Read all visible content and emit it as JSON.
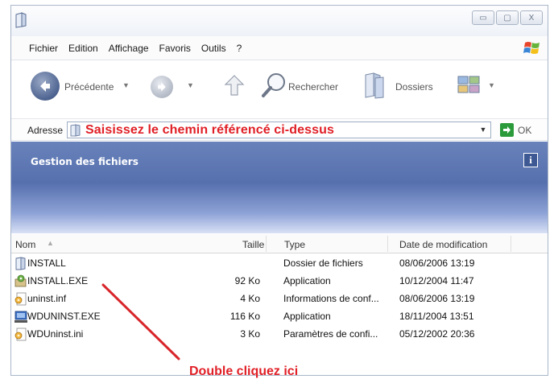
{
  "window": {
    "title_icon": "folder-icon",
    "buttons": [
      "minimize",
      "maximize",
      "close"
    ],
    "minimize_glyph": "▭",
    "maximize_glyph": "▢",
    "close_glyph": "X"
  },
  "menu": {
    "items": [
      "Fichier",
      "Edition",
      "Affichage",
      "Favoris",
      "Outils",
      "?"
    ]
  },
  "toolbar": {
    "back_label": "Précédente",
    "search_label": "Rechercher",
    "folders_label": "Dossiers"
  },
  "address": {
    "label": "Adresse",
    "value": "Saisissez le chemin référencé ci-dessus",
    "value_color": "#e01f26",
    "go_label": "OK"
  },
  "task_pane": {
    "title": "Gestion des fichiers",
    "info_glyph": "i"
  },
  "columns": {
    "name": "Nom",
    "size": "Taille",
    "type": "Type",
    "date": "Date de modification"
  },
  "files": [
    {
      "name": "INSTALL",
      "size": "",
      "type": "Dossier de fichiers",
      "date": "08/06/2006 13:19",
      "icon": "folder-icon"
    },
    {
      "name": "INSTALL.EXE",
      "size": "92 Ko",
      "type": "Application",
      "date": "10/12/2004 11:47",
      "icon": "installer-icon"
    },
    {
      "name": "uninst.inf",
      "size": "4 Ko",
      "type": "Informations de conf...",
      "date": "08/06/2006 13:19",
      "icon": "settings-file-icon"
    },
    {
      "name": "WDUNINST.EXE",
      "size": "116 Ko",
      "type": "Application",
      "date": "18/11/2004 13:51",
      "icon": "application-icon"
    },
    {
      "name": "WDUninst.ini",
      "size": "3 Ko",
      "type": "Paramètres de confi...",
      "date": "05/12/2002 20:36",
      "icon": "settings-file-icon"
    }
  ],
  "annotation": {
    "text": "Double cliquez ici",
    "color": "#e01f26"
  }
}
